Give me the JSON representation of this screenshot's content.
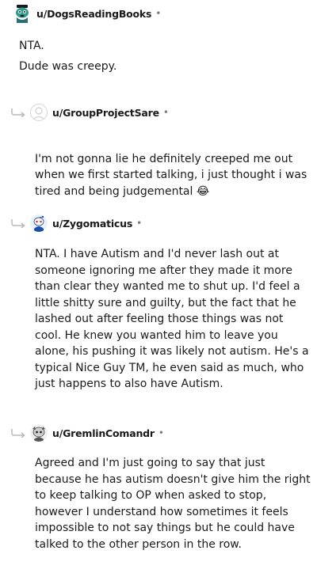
{
  "comments": [
    {
      "username": "u/DogsReadingBooks",
      "separator": "•",
      "avatar_icon": "dog-avatar-icon",
      "body_lines": "NTA.\nDude was creepy."
    },
    {
      "username": "u/GroupProjectSare",
      "separator": "•",
      "avatar_icon": "default-avatar-icon",
      "reply_icon": "reply-arrow-icon",
      "body_lines": "I'm not gonna lie he definitely creeped me out\nwhen we first started talking, i just thought i was\ntired and being judgemental",
      "emoji": "😂"
    },
    {
      "username": "u/Zygomaticus",
      "separator": "•",
      "avatar_icon": "snoo-avatar-icon",
      "reply_icon": "reply-arrow-icon",
      "body_lines": "NTA. I have Autism and I'd never lash out at\nsomeone ignoring me after they made it more\nthan clear they wanted me to shut up. I'd feel a\nlittle shitty sure and guilty, but the fact that he\nlashed out after feeling those things was not\ncool. He knew you wanted him to leave you\nalone, his pushing it was likely not autism. He's a\ntypical Nice Guy TM, he even said as much, who\njust happens to also have Autism."
    },
    {
      "username": "u/GremlinComandr",
      "separator": "•",
      "avatar_icon": "gremlin-avatar-icon",
      "reply_icon": "reply-arrow-icon",
      "body_lines": "Agreed and I'm just going to say that just\nbecause he has autism doesn't give him the right\nto keep talking to OP when asked to stop,\nhowever I understand how sometimes it feels\nimpossible to not say things but he could have\ntalked to the other person in the row."
    }
  ],
  "colors": {
    "text": "#1a1a1b",
    "meta": "#7c7c7c",
    "reply_line": "#b8b8b8"
  }
}
